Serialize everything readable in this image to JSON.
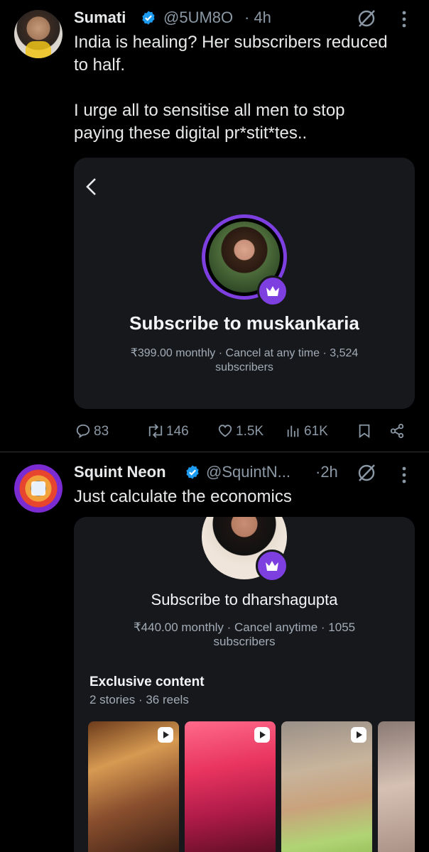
{
  "tweet1": {
    "name": "Sumati",
    "handle": "@5UM8O",
    "time": "· 4h",
    "text_line1": "India is healing? Her subscribers reduced",
    "text_line2": "to half.",
    "text_line3": "I urge all to sensitise all men to stop",
    "text_line4": "paying these digital pr*stit*tes..",
    "card": {
      "title": "Subscribe to muskankaria",
      "price_line1": "₹399.00 monthly · Cancel at any time · 3,524",
      "price_line2": "subscribers"
    },
    "metrics": {
      "replies": "83",
      "reposts": "146",
      "likes": "1.5K",
      "views": "61K"
    }
  },
  "tweet2": {
    "name": "Squint Neon",
    "handle": "@SquintN...",
    "time": "·2h",
    "text": "Just calculate the economics",
    "card": {
      "title": "Subscribe to dharshagupta",
      "price_line1": "₹440.00 monthly · Cancel anytime · 1055",
      "price_line2": "subscribers",
      "section_title": "Exclusive content",
      "section_sub": "2 stories · 36 reels"
    }
  },
  "colors": {
    "background": "#000000",
    "card": "#16181c",
    "text": "#e7e9ea",
    "muted": "#8b98a5",
    "verified": "#1d9bf0",
    "premium_purple": "#7e3fe0"
  },
  "icons": [
    "verified-icon",
    "grok-icon",
    "more-icon",
    "back-chevron-icon",
    "crown-icon",
    "reply-icon",
    "repost-icon",
    "like-icon",
    "views-icon",
    "bookmark-icon",
    "share-icon",
    "play-icon"
  ]
}
